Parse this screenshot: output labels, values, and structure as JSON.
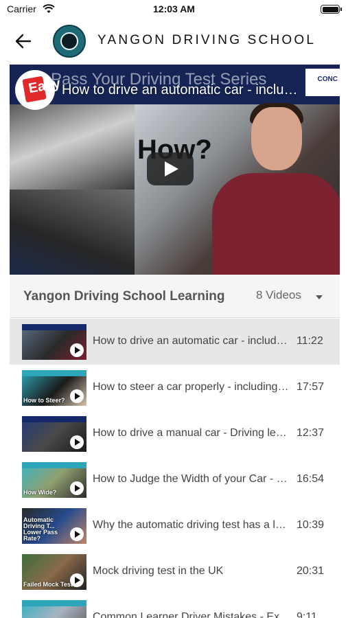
{
  "status_bar": {
    "carrier": "Carrier",
    "time": "12:03 AM"
  },
  "header": {
    "title": "YANGON DRIVING SCHOOL"
  },
  "player": {
    "banner_text": "Pass Your Driving Test Series",
    "brand_text": "CONC",
    "badge_text": "Easy",
    "overlay_text": "How?",
    "video_title": "How to drive an automatic car - including test tips"
  },
  "playlist": {
    "title": "Yangon Driving School Learning",
    "count_label": "8 Videos",
    "videos": [
      {
        "title": "How to drive an automatic car - including test tips",
        "duration": "11:22",
        "caption": "",
        "active": true
      },
      {
        "title": "How to steer a car properly - including test tips",
        "duration": "17:57",
        "caption": "How to Steer?"
      },
      {
        "title": "How to drive a manual car - Driving lesson",
        "duration": "12:37",
        "caption": ""
      },
      {
        "title": "How to Judge the Width of your Car - Driving lesson",
        "duration": "16:54",
        "caption": "How Wide?"
      },
      {
        "title": "Why the automatic driving test has a lower pass rate",
        "duration": "10:39",
        "caption": "Automatic Driving T... Lower Pass Rate?"
      },
      {
        "title": "Mock driving test in the UK",
        "duration": "20:31",
        "caption": "Failed Mock Test"
      },
      {
        "title": "Common Learner Driver Mistakes - Ex...",
        "duration": "9:11",
        "caption": ""
      }
    ]
  },
  "colors": {
    "accent_banner": "#152455",
    "active_row": "#e6e7e9"
  },
  "icons": {
    "back": "arrow-left-icon",
    "wifi": "wifi-icon",
    "battery": "battery-icon",
    "more": "more-vertical-icon",
    "dropdown": "caret-down-icon",
    "play": "play-icon"
  }
}
